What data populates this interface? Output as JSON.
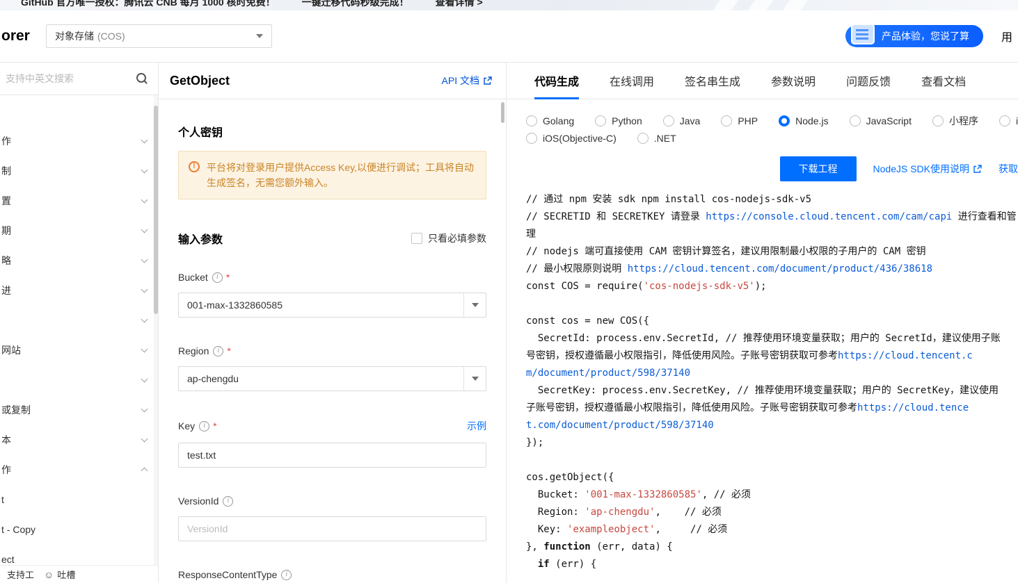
{
  "colors": {
    "accent": "#006eff",
    "link": "#0052d9",
    "url": "#0b5cd8",
    "string": "#c7473f",
    "required": "#e54545",
    "warning_bg": "#fdf3e2",
    "warning_border": "#f3dcb6",
    "warning_text": "#c98428"
  },
  "banner": {
    "text1": "GitHub 官方唯一授权：腾讯云 CNB 每月 1000 核时免费！",
    "text2": "一键迁移代码秒级完成！",
    "link": "查看详情 >"
  },
  "header": {
    "logo_text": "orer",
    "product_name": "对象存储",
    "product_suffix": "(COS)",
    "feedback_button": "产品体验，您说了算",
    "right_text": "用"
  },
  "sidebar": {
    "search_placeholder": "支持中英文搜索",
    "items": [
      {
        "label": "作",
        "chevron": "down"
      },
      {
        "label": "制",
        "chevron": "down"
      },
      {
        "label": "置",
        "chevron": "down"
      },
      {
        "label": "期",
        "chevron": "down"
      },
      {
        "label": "略",
        "chevron": "down"
      },
      {
        "label": "进",
        "chevron": "down"
      },
      {
        "label": "",
        "chevron": "down"
      },
      {
        "label": "网站",
        "chevron": "down"
      },
      {
        "label": "",
        "chevron": "down"
      },
      {
        "label": "或复制",
        "chevron": "down"
      },
      {
        "label": "本",
        "chevron": "down"
      },
      {
        "label": "作",
        "chevron": "up"
      },
      {
        "label": "t",
        "chevron": "none"
      },
      {
        "label": "t - Copy",
        "chevron": "none"
      },
      {
        "label": "ect",
        "chevron": "none"
      }
    ],
    "footer_left": "支持工",
    "footer_feedback": "吐槽"
  },
  "middle": {
    "title": "GetObject",
    "doc_link": "API 文档",
    "section_personal_key": "个人密钥",
    "warning": "平台将对登录用户提供Access Key,以便进行调试；工具将自动生成签名，无需您额外输入。",
    "section_input_params": "输入参数",
    "required_only_label": "只看必填参数",
    "required_mark": "*",
    "fields": {
      "bucket": {
        "label": "Bucket",
        "value": "001-max-1332860585"
      },
      "region": {
        "label": "Region",
        "value": "ap-chengdu"
      },
      "key": {
        "label": "Key",
        "value": "test.txt",
        "example_link": "示例"
      },
      "versionid": {
        "label": "VersionId",
        "placeholder": "VersionId"
      },
      "response_content_type": {
        "label": "ResponseContentType"
      }
    }
  },
  "right": {
    "tabs": [
      {
        "label": "代码生成",
        "active": true
      },
      {
        "label": "在线调用"
      },
      {
        "label": "签名串生成"
      },
      {
        "label": "参数说明"
      },
      {
        "label": "问题反馈"
      },
      {
        "label": "查看文档"
      }
    ],
    "language_rows": [
      [
        {
          "label": "Golang"
        },
        {
          "label": "Python"
        },
        {
          "label": "Java"
        },
        {
          "label": "PHP"
        },
        {
          "label": "Node.js",
          "checked": true
        },
        {
          "label": "JavaScript"
        },
        {
          "label": "小程序"
        },
        {
          "label": "iOS(S"
        }
      ],
      [
        {
          "label": "iOS(Objective-C)"
        },
        {
          "label": ".NET"
        }
      ]
    ],
    "download_button": "下载工程",
    "sdk_link": "NodeJS SDK使用说明",
    "get_link": "获取",
    "code": {
      "lines": [
        [
          {
            "t": "// 通过 npm 安装 sdk npm install cos-nodejs-sdk-v5"
          }
        ],
        [
          {
            "t": "// SECRETID 和 SECRETKEY 请登录 "
          },
          {
            "t": "https://console.cloud.tencent.com/cam/capi",
            "c": "url"
          },
          {
            "t": " 进行查看和管"
          }
        ],
        [
          {
            "t": "理"
          }
        ],
        [
          {
            "t": "// nodejs 端可直接使用 CAM 密钥计算签名，建议用限制最小权限的子用户的 CAM 密钥"
          }
        ],
        [
          {
            "t": "// 最小权限原则说明 "
          },
          {
            "t": "https://cloud.tencent.com/document/product/436/38618",
            "c": "url"
          }
        ],
        [
          {
            "t": "const COS = require("
          },
          {
            "t": "'cos-nodejs-sdk-v5'",
            "c": "str"
          },
          {
            "t": ");"
          }
        ],
        [],
        [
          {
            "t": "const cos = new COS({"
          }
        ],
        [
          {
            "t": "  SecretId: process.env.SecretId, // 推荐使用环境变量获取；用户的 SecretId，建议使用子账"
          }
        ],
        [
          {
            "t": "号密钥，授权遵循最小权限指引，降低使用风险。子账号密钥获取可参考"
          },
          {
            "t": "https://cloud.tencent.c",
            "c": "url"
          }
        ],
        [
          {
            "t": "m/document/product/598/37140",
            "c": "url"
          }
        ],
        [
          {
            "t": "  SecretKey: process.env.SecretKey, // 推荐使用环境变量获取；用户的 SecretKey，建议使用"
          }
        ],
        [
          {
            "t": "子账号密钥，授权遵循最小权限指引，降低使用风险。子账号密钥获取可参考"
          },
          {
            "t": "https://cloud.tence",
            "c": "url"
          }
        ],
        [
          {
            "t": "t.com/document/product/598/37140",
            "c": "url"
          }
        ],
        [
          {
            "t": "});"
          }
        ],
        [],
        [
          {
            "t": "cos.getObject({"
          }
        ],
        [
          {
            "t": "  Bucket: "
          },
          {
            "t": "'001-max-1332860585'",
            "c": "str"
          },
          {
            "t": ", // 必须"
          }
        ],
        [
          {
            "t": "  Region: "
          },
          {
            "t": "'ap-chengdu'",
            "c": "str"
          },
          {
            "t": ",    // 必须"
          }
        ],
        [
          {
            "t": "  Key: "
          },
          {
            "t": "'exampleobject'",
            "c": "str"
          },
          {
            "t": ",     // 必须"
          }
        ],
        [
          {
            "t": "}, "
          },
          {
            "t": "function",
            "c": "kw"
          },
          {
            "t": " (err, data) {"
          }
        ],
        [
          {
            "t": "  "
          },
          {
            "t": "if",
            "c": "kw"
          },
          {
            "t": " (err) {"
          }
        ]
      ]
    }
  }
}
